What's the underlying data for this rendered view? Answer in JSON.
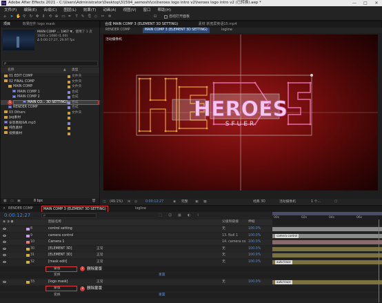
{
  "window": {
    "title": "Adobe After Effects 2021 - C:\\Users\\Administrator\\Desktop\\31594_aemoshi\\cs\\heroes logo intro v2\\heroes logo intro v2 (已转换).aep *",
    "controls": [
      "—",
      "□",
      "✕"
    ]
  },
  "menu": [
    "文件(F)",
    "编辑(E)",
    "合成(C)",
    "图层(L)",
    "效果(T)",
    "动画(A)",
    "视图(V)",
    "窗口",
    "帮助(H)"
  ],
  "toolbar": {
    "snap_label": "自动打开面板"
  },
  "project": {
    "tabs": [
      "项目",
      "效果控件 logo mask"
    ],
    "preview": {
      "name": "MAIN COMP ... 1967",
      "used": "▼，使用了 1 次",
      "size": "1920 x 1080 (1.00)",
      "duration": "Δ 0:00:17:27, 29.97 fps"
    },
    "search_placeholder": "ρ",
    "columns": {
      "name": "名称",
      "type": "类型",
      "label": "▲"
    },
    "rows": [
      {
        "name": "01 EDIT COMP",
        "type": "文件夹",
        "kind": "folder",
        "indent": 0,
        "selected": false
      },
      {
        "name": "02 FINAL COMP",
        "type": "文件夹",
        "kind": "folder",
        "indent": 0,
        "selected": false
      },
      {
        "name": "MAIN COMP",
        "type": "文件夹",
        "kind": "folder",
        "indent": 1,
        "selected": false
      },
      {
        "name": "MAIN COMP 1",
        "type": "合成",
        "kind": "comp",
        "indent": 2,
        "selected": false
      },
      {
        "name": "MAIN COMP 2",
        "type": "合成",
        "kind": "comp",
        "indent": 2,
        "selected": false
      },
      {
        "name": "MAIN CO... 3D SETTING]",
        "type": "合成",
        "kind": "comp",
        "indent": 2,
        "selected": true,
        "badge": "1"
      },
      {
        "name": "RENDER COMP",
        "type": "合成",
        "kind": "comp",
        "indent": 1,
        "selected": false
      },
      {
        "name": "03 Others",
        "type": "文件夹",
        "kind": "folder",
        "indent": 0,
        "selected": false
      },
      {
        "name": "jpg素材",
        "type": "",
        "kind": "folder",
        "indent": 0,
        "selected": false
      },
      {
        "name": "安装教程&N.mp3",
        "type": "",
        "kind": "comp",
        "indent": 0,
        "selected": false
      },
      {
        "name": "纯色素材",
        "type": "",
        "kind": "folder",
        "indent": 0,
        "selected": false
      },
      {
        "name": "视频素材",
        "type": "",
        "kind": "folder",
        "indent": 0,
        "selected": false
      }
    ],
    "footer_bpc": "8 bpc"
  },
  "viewer": {
    "tabs": [
      "合成 MAIN COMP 3 (ELEMENT 3D SETTING)",
      "素材 新宽屏英语15.mp4"
    ],
    "comp_tabs": [
      "RENDER COMP",
      "MAIN COMP 3 (ELEMENT 3D SETTING)",
      "logline"
    ],
    "cam_label": "活动摄像机",
    "logo_text": "HEROES",
    "subtitle": "SFUER",
    "zoom": "(49.1%)",
    "timecode": "0:00:12:27",
    "res": "完整",
    "renderer": "经典 3D",
    "camera": "活动摄像机",
    "views": "1 个..."
  },
  "timeline": {
    "tabs": [
      "RENDER COMP",
      "MAIN COMP 3 (ELEMENT 3D SETTING)",
      "logline"
    ],
    "timecode": "0:00:12:27",
    "columns": {
      "layer_name": "图层名称",
      "parent": "父级和链接",
      "stretch": "伸缩"
    },
    "ruler": [
      "00s",
      "02s",
      "04s",
      "06s"
    ],
    "layers": [
      {
        "num": "8",
        "name": "control setting",
        "color": "#c4a0e0",
        "mode": "",
        "parent": "无",
        "stretch": "100.0%",
        "bar_color": "#8b8b8b",
        "bar_label": ""
      },
      {
        "num": "9",
        "name": "camera control",
        "color": "#c4a0e0",
        "mode": "",
        "parent": "13. Null 1",
        "stretch": "100.0%",
        "bar_color": "#8b8b8b",
        "bar_label": "camera control"
      },
      {
        "num": "10",
        "name": "Camera 1",
        "color": "#e07f7f",
        "mode": "",
        "parent": "14. camera co",
        "stretch": "100.0%",
        "bar_color": "#8a6a6a",
        "bar_label": ""
      },
      {
        "num": "30",
        "name": "[ELEMENT 3D]",
        "color": "#c9b34b",
        "mode": "正常",
        "parent": "无",
        "stretch": "100.0%",
        "bar_color": "#7a7240",
        "bar_label": ""
      },
      {
        "num": "31",
        "name": "[ELEMENT 3D]",
        "color": "#c9b34b",
        "mode": "正常",
        "parent": "无",
        "stretch": "100.0%",
        "bar_color": "#7a7240",
        "bar_label": ""
      },
      {
        "num": "32",
        "name": "[mask edit]",
        "color": "#c9b34b",
        "mode": "正常",
        "parent": "无",
        "stretch": "100.0%",
        "bar_color": "#7a7240",
        "bar_label": "auto trace"
      },
      {
        "num": "",
        "name": "蒙版",
        "color": "",
        "mode": "",
        "parent": "",
        "stretch": "",
        "bar_color": "",
        "bar_label": "",
        "sub": true,
        "annot": "删除蒙版",
        "badge": "2"
      },
      {
        "num": "",
        "name": "变换",
        "color": "",
        "mode": "重置",
        "parent": "",
        "stretch": "",
        "bar_color": "",
        "bar_label": "",
        "sub": true
      },
      {
        "num": "33",
        "name": "[logo mask]",
        "color": "#c9b34b",
        "mode": "正常",
        "parent": "无",
        "stretch": "100.0%",
        "bar_color": "#7a7240",
        "bar_label": "auto trace"
      },
      {
        "num": "",
        "name": "蒙版",
        "color": "",
        "mode": "",
        "parent": "",
        "stretch": "",
        "bar_color": "",
        "bar_label": "",
        "sub": true,
        "annot": "删除蒙版",
        "badge": "3"
      },
      {
        "num": "",
        "name": "变换",
        "color": "",
        "mode": "重置",
        "parent": "",
        "stretch": "",
        "bar_color": "",
        "bar_label": "",
        "sub": true
      }
    ]
  },
  "colors": {
    "accent_blue": "#2d8ceb",
    "annotation_red": "#e23a3a",
    "logo_pink": "#f0a0e0",
    "outline_orange": "#e8a030"
  }
}
